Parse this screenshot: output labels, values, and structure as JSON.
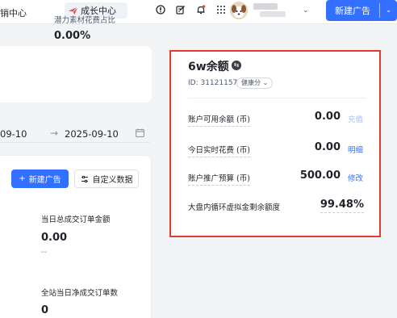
{
  "topbar": {
    "left_crumb": "销中心",
    "growth_center": "成长中心",
    "new_ad_label": "新建广告",
    "icons": [
      "plane-icon",
      "alert-icon",
      "edit-icon",
      "bell-icon",
      "grid-icon"
    ],
    "colors": {
      "accent": "#3370ff"
    }
  },
  "card_metric": {
    "label": "潜力素材花费占比",
    "value": "0.00%"
  },
  "date_range": {
    "start": "09-10",
    "end": "2025-09-10"
  },
  "actions": {
    "new_ad": "新建广告",
    "custom_data": "自定义数据"
  },
  "metrics": [
    {
      "label": "当日总成交订单金额",
      "value": "0.00",
      "sub": "--"
    },
    {
      "label": "全站当日净成交订单数",
      "value": "0"
    }
  ],
  "wallet": {
    "title": "6w余额",
    "id_text": "ID: 31121157",
    "health_badge": "健康分 ⌄",
    "rows": [
      {
        "label": "账户可用余额 (币)",
        "value": "0.00",
        "link": "充值",
        "link_disabled": true
      },
      {
        "label": "今日实时花费 (币)",
        "value": "0.00",
        "link": "明细",
        "link_disabled": false
      },
      {
        "label": "账户推广预算 (币)",
        "value": "500.00",
        "link": "修改",
        "link_disabled": false
      }
    ],
    "inner_label": "大盘内循环虚拟金剩余额度",
    "inner_value": "99.48%",
    "highlight_color": "#e23c2f"
  }
}
